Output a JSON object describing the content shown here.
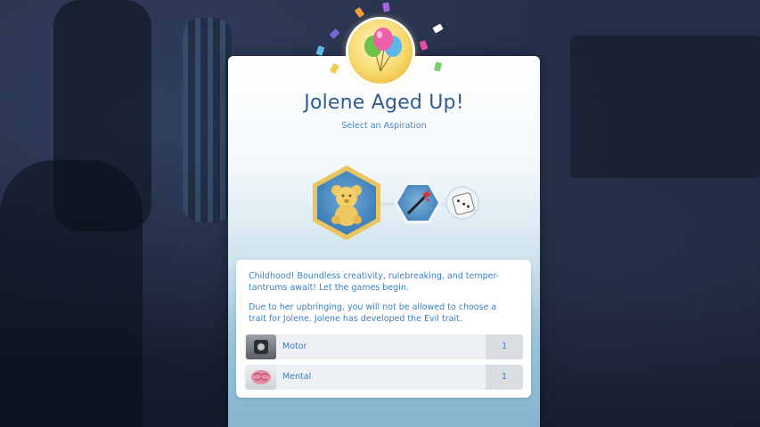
{
  "dialog": {
    "title": "Jolene Aged Up!",
    "subtitle": "Select an Aspiration",
    "icons": {
      "celebration": "balloons-icon",
      "aspiration_selected": "teddy-bear-icon",
      "aspiration_option": "trident-icon",
      "random": "dice-icon"
    }
  },
  "description": {
    "paragraph1": "Childhood! Boundless creativity, rulebreaking, and temper-tantrums await! Let the games begin.",
    "paragraph2": "Due to her upbringing, you will not be allowed to choose a trait for Jolene. Jolene has developed the Evil trait."
  },
  "skills": [
    {
      "label": "Motor",
      "value": "1",
      "icon": "motor-skill-icon"
    },
    {
      "label": "Mental",
      "value": "1",
      "icon": "brain-icon"
    }
  ],
  "colors": {
    "title": "#2f5b8e",
    "text_blue": "#3b7dbd",
    "gold_frame": "#e9c560",
    "aspiration_blue": "#3f7fb8"
  }
}
